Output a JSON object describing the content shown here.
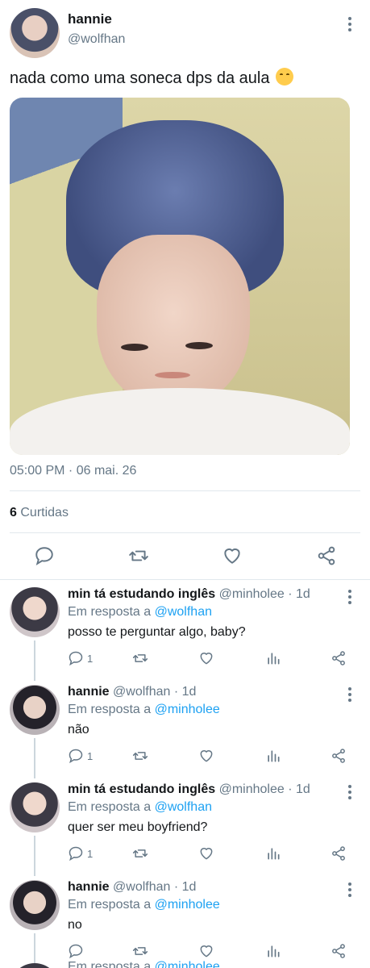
{
  "tweet": {
    "display_name": "hannie",
    "handle": "@wolfhan",
    "text": "nada como uma soneca dps da aula",
    "emoji": "kissing-smiling-eyes-emoji",
    "timestamp": "05:00 PM · 06 mai. 26",
    "likes_count": "6",
    "likes_label": "Curtidas"
  },
  "replies": [
    {
      "display_name": "min tá estudando inglês",
      "handle": "@minholee",
      "age": "· 1d",
      "in_reply_prefix": "Em resposta a",
      "in_reply_to": "@wolfhan",
      "text": "posso te perguntar algo, baby?",
      "reply_count": "1"
    },
    {
      "display_name": "hannie",
      "handle": "@wolfhan",
      "age": "· 1d",
      "in_reply_prefix": "Em resposta a",
      "in_reply_to": "@minholee",
      "text": "não",
      "reply_count": "1"
    },
    {
      "display_name": "min tá estudando inglês",
      "handle": "@minholee",
      "age": "· 1d",
      "in_reply_prefix": "Em resposta a",
      "in_reply_to": "@wolfhan",
      "text": "quer ser meu boyfriend?",
      "reply_count": "1"
    },
    {
      "display_name": "hannie",
      "handle": "@wolfhan",
      "age": "· 1d",
      "in_reply_prefix": "Em resposta a",
      "in_reply_to": "@minholee",
      "text": "no",
      "reply_count": ""
    }
  ],
  "peek": {
    "in_reply_prefix": "Em resposta a",
    "in_reply_to": "@minholee"
  },
  "colors": {
    "text": "#14171a",
    "secondary": "#657786",
    "link": "#1da1f2",
    "divider": "#e1e8ed"
  }
}
